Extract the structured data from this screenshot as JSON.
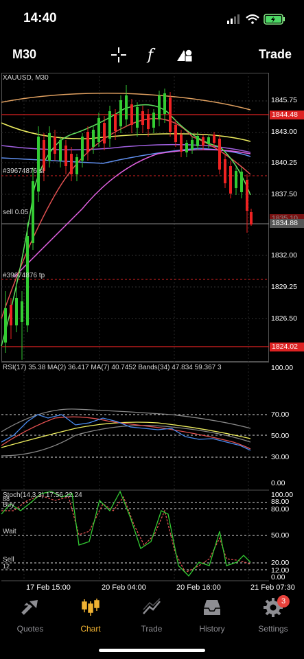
{
  "status_bar": {
    "time": "14:40"
  },
  "toolbar": {
    "timeframe": "M30",
    "trade_label": "Trade",
    "icons": [
      "crosshair-icon",
      "indicators-icon",
      "objects-icon"
    ]
  },
  "chart": {
    "symbol": "XAUUSD, M30",
    "order_labels": {
      "sl": "#39674876 sl",
      "sell": "sell 0.05",
      "tp": "#39674876 tp"
    },
    "price_axis": [
      "1845.75",
      "1843.00",
      "1840.25",
      "1837.50",
      "1832.00",
      "1829.25",
      "1826.50"
    ],
    "price_boxes": {
      "upper_level": "1844.48",
      "current": "1834.88",
      "lower_level": "1824.02",
      "hidden": "1835.10"
    },
    "rsi_label": "RSI(17) 35.38 MA(2) 36.417 MA(7) 40.7452 Bands(34) 47.834 59.367 3",
    "rsi_axis": [
      "100.00",
      "70.00",
      "50.00",
      "30.00",
      "0.00"
    ],
    "stoch_label": "Stoch(14,3,3) 17.56 22.24",
    "stoch_levels": {
      "l88": "88",
      "buy": "Buy",
      "wait": "Wait",
      "sell": "Sell",
      "l12": "12"
    },
    "stoch_axis": [
      "100.00",
      "88.00",
      "80.00",
      "50.00",
      "20.00",
      "12.00",
      "0.00"
    ],
    "time_axis": [
      "17 Feb 15:00",
      "20 Feb 04:00",
      "20 Feb 16:00",
      "21 Feb 07:30"
    ],
    "colors": {
      "up": "#33cc33",
      "down": "#ee2222",
      "level": "#dd2222",
      "accent": "#f0b232"
    }
  },
  "tabs": [
    {
      "label": "Quotes",
      "icon": "quotes-icon"
    },
    {
      "label": "Chart",
      "icon": "chart-icon",
      "active": true
    },
    {
      "label": "Trade",
      "icon": "trade-icon"
    },
    {
      "label": "History",
      "icon": "history-icon"
    },
    {
      "label": "Settings",
      "icon": "settings-icon",
      "badge": "3"
    }
  ]
}
